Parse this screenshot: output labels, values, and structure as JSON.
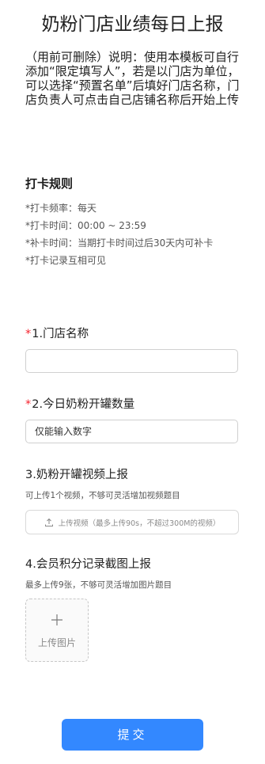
{
  "form": {
    "title": "奶粉门店业绩每日上报",
    "description": "（用前可删除）说明：使用本模板可自行添加“限定填写人”，若是以门店为单位，可以选择“预置名单”后填好门店名称，门店负责人可点击自己店铺名称后开始上传"
  },
  "rules": {
    "title": "打卡规则",
    "items": [
      "*打卡频率：每天",
      "*打卡时间：00:00 ~ 23:59",
      "*补卡时间：当期打卡时间过后30天内可补卡",
      "*打卡记录互相可见"
    ]
  },
  "questions": [
    {
      "required_mark": "*",
      "label": "1.门店名称",
      "value": ""
    },
    {
      "required_mark": "*",
      "label": "2.今日奶粉开罐数量",
      "placeholder": "仅能输入数字"
    },
    {
      "label": "3.奶粉开罐视频上报",
      "hint": "可上传1个视频，不够可灵活增加视频题目",
      "upload_label": "上传视频（最多上传90s，不超过300M的视频）"
    },
    {
      "label": "4.会员积分记录截图上报",
      "hint": "最多上传9张，不够可灵活增加图片题目",
      "upload_label": "上传图片"
    }
  ],
  "submit_label": "提交",
  "colors": {
    "accent": "#3388ff",
    "required": "#f5222d",
    "border": "#d0d0d0"
  },
  "icons": {
    "video_upload": "upload-icon",
    "image_upload": "plus-icon"
  }
}
